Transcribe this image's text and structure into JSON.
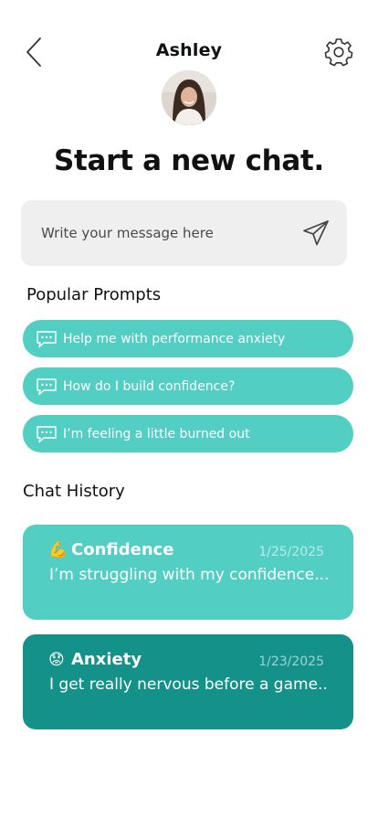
{
  "header": {
    "contact_name": "Ashley"
  },
  "main": {
    "title": "Start a new chat.",
    "message_input": {
      "placeholder": "Write your message here",
      "value": ""
    }
  },
  "popular_prompts": {
    "label": "Popular Prompts",
    "items": [
      {
        "label": "Help me with performance anxiety"
      },
      {
        "label": "How do I build confidence?"
      },
      {
        "label": "I’m feeling a little burned out"
      }
    ]
  },
  "chat_history": {
    "label": "Chat History",
    "items": [
      {
        "emoji": "💪",
        "title": "Confidence",
        "date": "1/25/2025",
        "preview": "I’m struggling with my confidence..."
      },
      {
        "emoji": "😟",
        "title": "Anxiety",
        "date": "1/23/2025",
        "preview": "I get really nervous before a game.."
      }
    ]
  },
  "colors": {
    "accent_light": "#52cec3",
    "accent_dark": "#14928a",
    "input_bg": "#efefef"
  },
  "icons": {
    "back": "chevron-left-icon",
    "settings": "gear-icon",
    "send": "paper-plane-icon",
    "prompt": "chat-bubble-icon"
  }
}
